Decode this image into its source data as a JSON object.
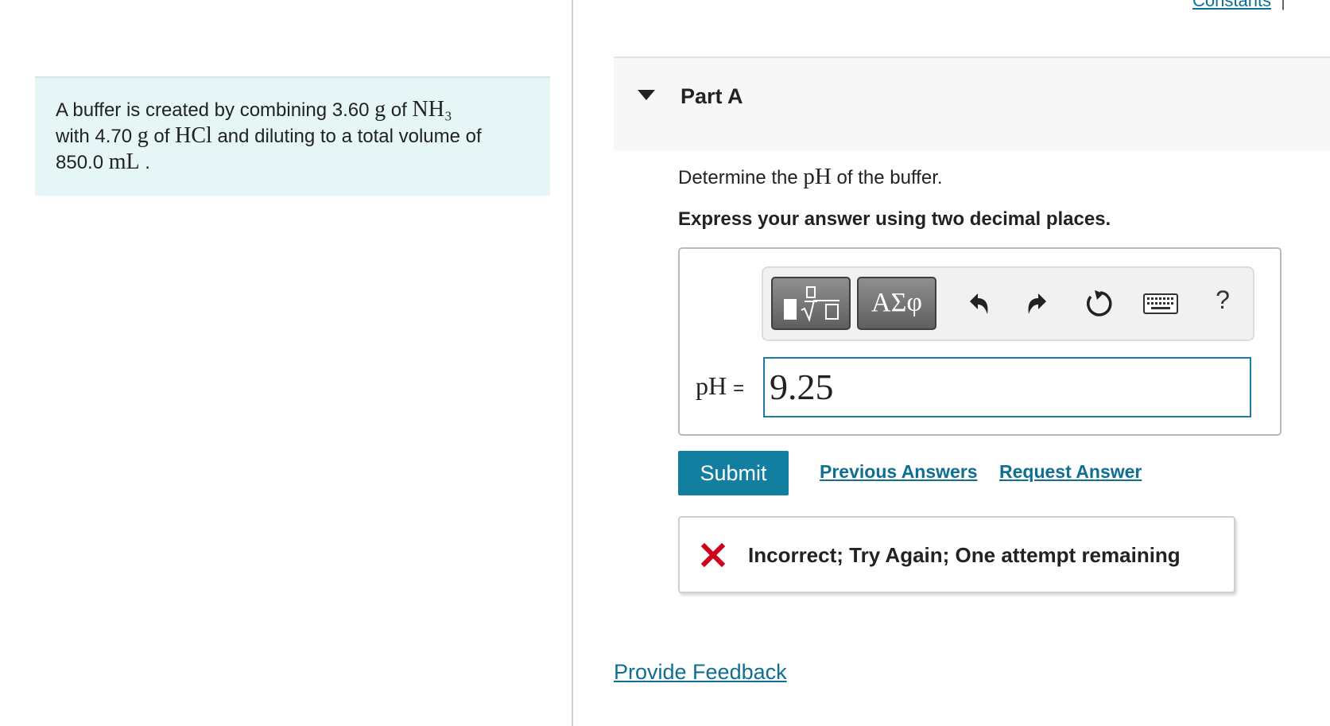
{
  "header": {
    "constants_link": "Constants",
    "separator": "|"
  },
  "problem": {
    "t1": "A buffer is created by combining 3.60 ",
    "unit_g": "g",
    "t2": " of ",
    "nh3": "NH₃",
    "t3": "with 4.70 ",
    "t4": " of ",
    "hcl": "HCl",
    "t5": " and diluting to a total volume of",
    "t6": "850.0 ",
    "unit_ml": "mL",
    "t7": " ."
  },
  "part": {
    "title": "Part A",
    "question_pre": "Determine the ",
    "question_ph": "pH",
    "question_post": " of the buffer.",
    "instruction": "Express your answer using two decimal places."
  },
  "toolbar": {
    "symbols_label": "ΑΣφ",
    "help_label": "?"
  },
  "answer": {
    "variable": "pH",
    "equals": "=",
    "value": "9.25"
  },
  "actions": {
    "submit_label": "Submit",
    "previous_answers": "Previous Answers",
    "request_answer": "Request Answer"
  },
  "feedback": {
    "message": "Incorrect; Try Again; One attempt remaining",
    "icon_color": "#d0021b"
  },
  "footer": {
    "provide_feedback": "Provide Feedback"
  },
  "colors": {
    "link": "#0d6f91",
    "submit": "#127fa1",
    "problem_bg": "#e6f5f6"
  }
}
